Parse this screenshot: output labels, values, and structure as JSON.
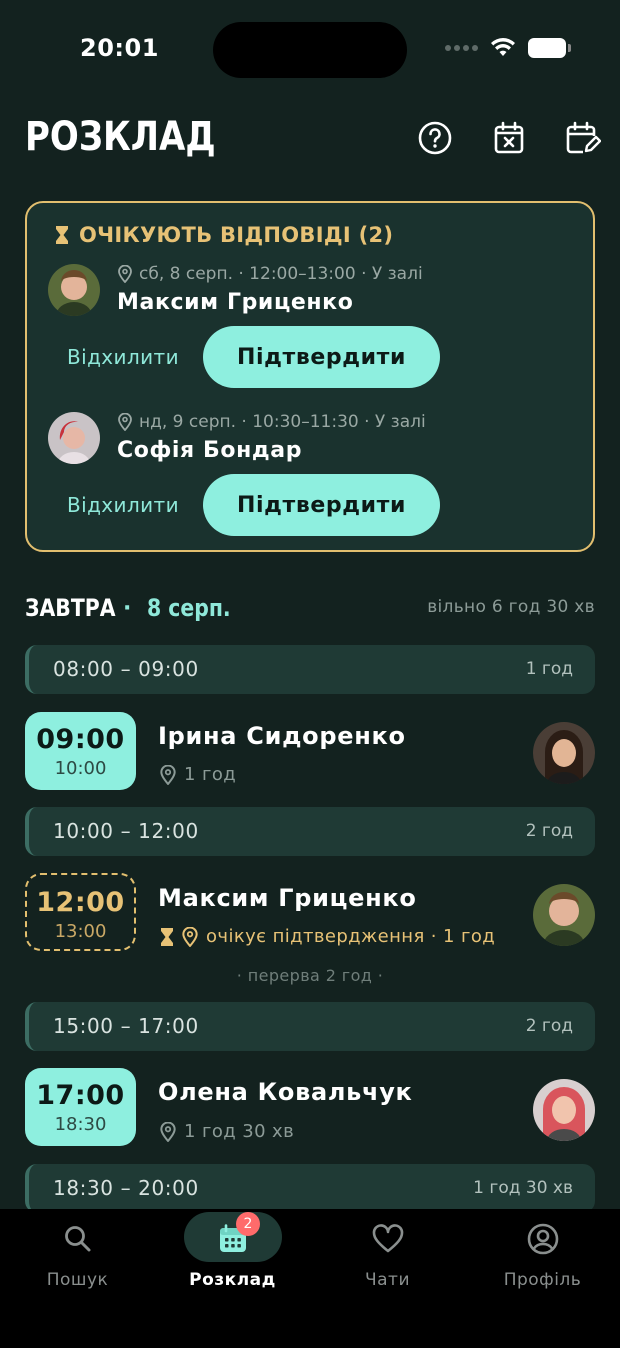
{
  "status_bar": {
    "time": "20:01"
  },
  "header": {
    "title": "РОЗКЛАД"
  },
  "pending": {
    "title": "ОЧІКУЮТЬ ВІДПОВІДІ (2)",
    "requests": [
      {
        "meta": "сб, 8 серп. · 12:00–13:00 · У залі",
        "name": "Максим Гриценко",
        "decline_label": "Відхилити",
        "confirm_label": "Підтвердити"
      },
      {
        "meta": "нд, 9 серп. · 10:30–11:30 · У залі",
        "name": "Софія Бондар",
        "decline_label": "Відхилити",
        "confirm_label": "Підтвердити"
      }
    ]
  },
  "day": {
    "label": "ЗАВТРА",
    "separator": "·",
    "date": "8 серп.",
    "free": "вільно 6 год 30 хв"
  },
  "free_slots": [
    {
      "range": "08:00 – 09:00",
      "duration": "1 год"
    },
    {
      "range": "10:00 – 12:00",
      "duration": "2 год"
    },
    {
      "range": "15:00 – 17:00",
      "duration": "2 год"
    },
    {
      "range": "18:30 – 20:00",
      "duration": "1 год 30 хв"
    }
  ],
  "appointments": [
    {
      "start": "09:00",
      "end": "10:00",
      "name": "Ірина Сидоренко",
      "sub": "1 год",
      "status": "confirmed"
    },
    {
      "start": "12:00",
      "end": "13:00",
      "name": "Максим Гриценко",
      "sub": "очікує підтвердження · 1 год",
      "status": "pending"
    },
    {
      "start": "17:00",
      "end": "18:30",
      "name": "Олена Ковальчук",
      "sub": "1 год 30 хв",
      "status": "confirmed"
    }
  ],
  "break_label": "· перерва 2 год ·",
  "tabs": [
    {
      "label": "Пошук",
      "icon": "search-icon"
    },
    {
      "label": "Розклад",
      "icon": "calendar-icon",
      "badge": "2",
      "active": true
    },
    {
      "label": "Чати",
      "icon": "heart-icon"
    },
    {
      "label": "Профіль",
      "icon": "profile-icon"
    }
  ],
  "colors": {
    "accent": "#8eefdf",
    "pending": "#e2bf6f",
    "background": "#13221f",
    "badge": "#ff6b6b"
  }
}
